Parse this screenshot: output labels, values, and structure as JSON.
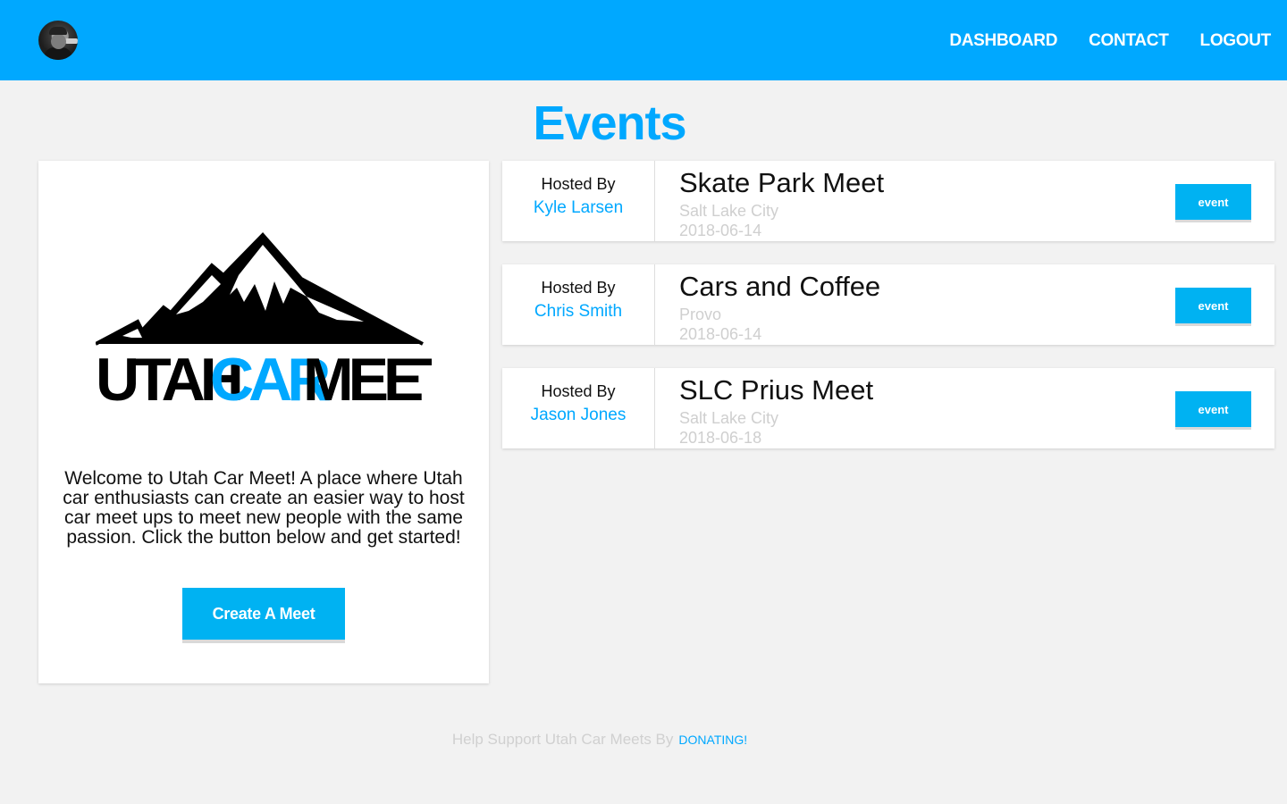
{
  "header": {
    "avatar_icon": "user-avatar",
    "nav": [
      "DASHBOARD",
      "CONTACT",
      "LOGOUT"
    ]
  },
  "page_title": "Events",
  "welcome": {
    "logo": {
      "word_utah": "UTAH",
      "word_car": "CAR",
      "word_meet": "MEET"
    },
    "text": "Welcome to Utah Car Meet! A place where Utah car enthusiasts can create an easier way to host car meet ups to meet new people with the same passion. Click the button below and get started!",
    "button": "Create A Meet"
  },
  "events": [
    {
      "hosted_label": "Hosted By",
      "host": "Kyle Larsen",
      "title": "Skate Park Meet",
      "city": "Salt Lake City",
      "date": "2018-06-14",
      "button": "event"
    },
    {
      "hosted_label": "Hosted By",
      "host": "Chris Smith",
      "title": "Cars and Coffee",
      "city": "Provo",
      "date": "2018-06-14",
      "button": "event"
    },
    {
      "hosted_label": "Hosted By",
      "host": "Jason Jones",
      "title": "SLC Prius Meet",
      "city": "Salt Lake City",
      "date": "2018-06-18",
      "button": "event"
    }
  ],
  "footer": {
    "text": "Help Support Utah Car Meets By",
    "link": "DONATING!"
  },
  "colors": {
    "primary": "#00a8ff",
    "button": "#00b2f2",
    "background": "#f2f2f2",
    "muted": "#cfcfcf"
  }
}
